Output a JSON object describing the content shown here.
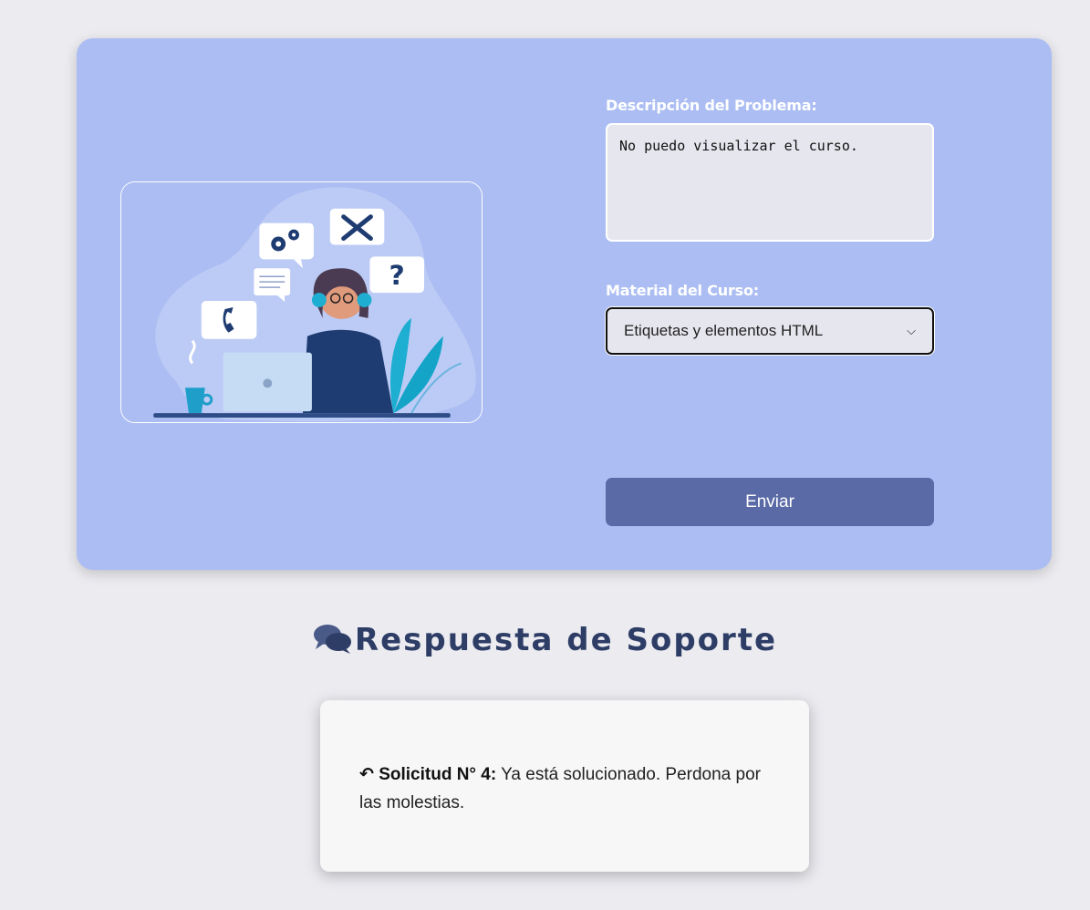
{
  "form": {
    "description_label": "Descripción del Problema:",
    "description_value": "No puedo visualizar el curso.",
    "material_label": "Material del Curso:",
    "material_selected": "Etiquetas y elementos HTML",
    "submit_label": "Enviar"
  },
  "illustration": {
    "bubble_question": "?"
  },
  "response": {
    "title": "Respuesta de Soporte",
    "request_label": "Solicitud N° 4:",
    "message": " Ya está solucionado. Perdona por las molestias."
  },
  "colors": {
    "background": "#ebebf0",
    "card": "#abbdf2",
    "button": "#5a6aa6",
    "title": "#2e3d66"
  }
}
